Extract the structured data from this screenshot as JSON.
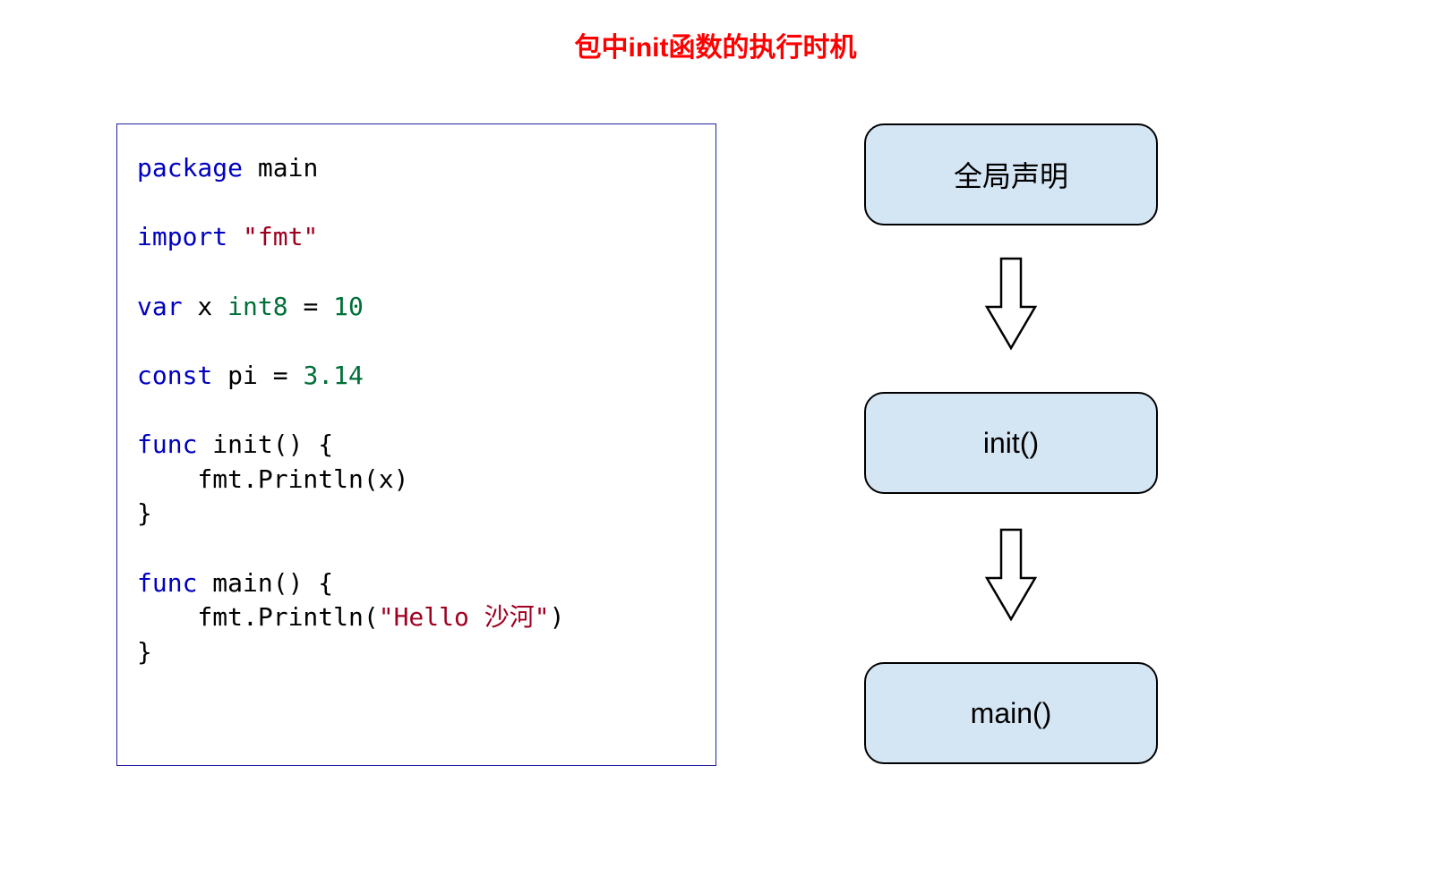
{
  "title": "包中init函数的执行时机",
  "code": {
    "line1": {
      "kw": "package",
      "rest": " main"
    },
    "line2": {
      "kw": "import",
      "sp": " ",
      "str": "\"fmt\""
    },
    "line3": {
      "kw": "var",
      "sp1": " x ",
      "typ": "int8",
      "sp2": " = ",
      "num": "10"
    },
    "line4": {
      "kw": "const",
      "sp": " pi = ",
      "num": "3.14"
    },
    "line5": {
      "kw": "func",
      "rest": " init() {"
    },
    "line6": "    fmt.Println(x)",
    "line7": "}",
    "line8": {
      "kw": "func",
      "rest": " main() {"
    },
    "line9": {
      "pre": "    fmt.Println(",
      "str": "\"Hello 沙河\"",
      "post": ")"
    },
    "line10": "}"
  },
  "flow": {
    "box1": "全局声明",
    "box2": "init()",
    "box3": "main()"
  }
}
